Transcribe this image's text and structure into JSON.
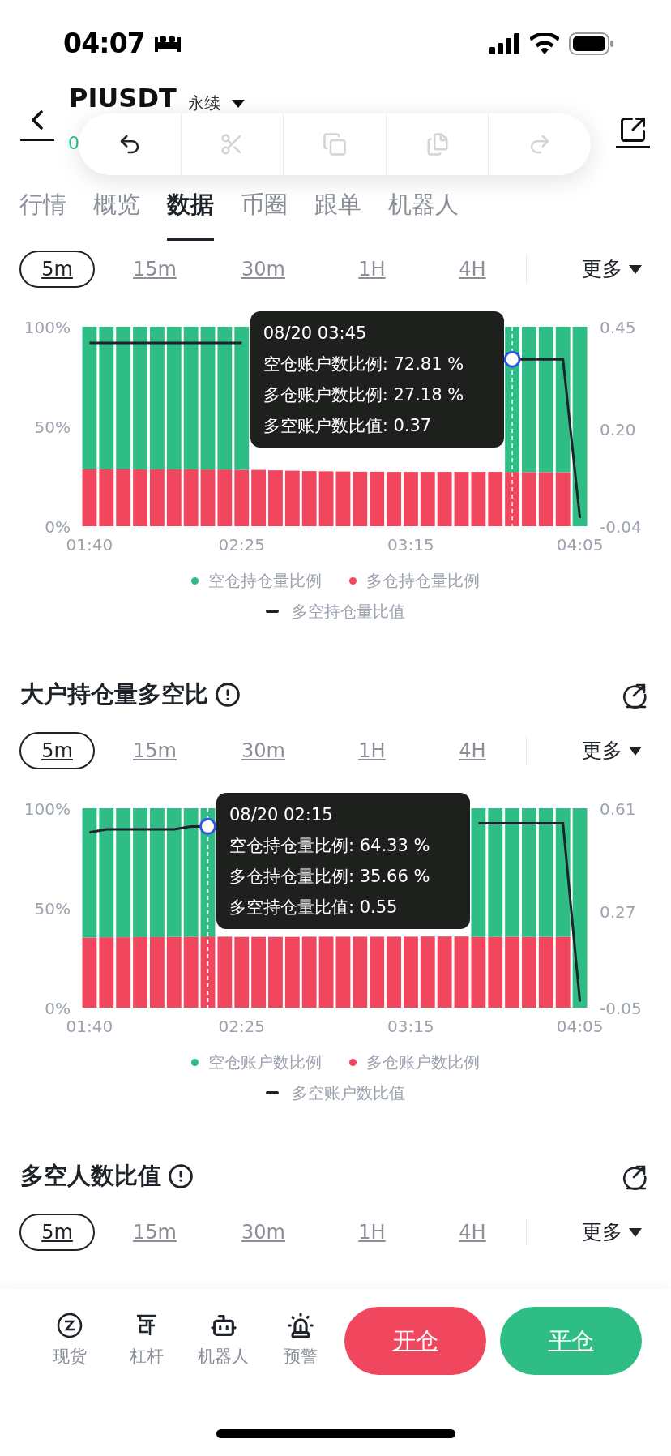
{
  "status_bar": {
    "time": "04:07"
  },
  "header": {
    "symbol": "PIUSDT",
    "contract": "永续",
    "price_fragment": "0"
  },
  "edit_toolbar": {
    "items": [
      {
        "kind": "undo",
        "disabled": false
      },
      {
        "kind": "cut",
        "disabled": true
      },
      {
        "kind": "copy",
        "disabled": true
      },
      {
        "kind": "paste",
        "disabled": true
      },
      {
        "kind": "redo",
        "disabled": true
      }
    ]
  },
  "tabs": [
    {
      "label": "行情",
      "selected": false
    },
    {
      "label": "概览",
      "selected": false
    },
    {
      "label": "数据",
      "selected": true
    },
    {
      "label": "币圈",
      "selected": false
    },
    {
      "label": "跟单",
      "selected": false
    },
    {
      "label": "机器人",
      "selected": false
    }
  ],
  "sections": [
    {
      "intervals": [
        {
          "label": "5m",
          "selected": true
        },
        {
          "label": "15m",
          "selected": false
        },
        {
          "label": "30m",
          "selected": false
        },
        {
          "label": "1H",
          "selected": false
        },
        {
          "label": "4H",
          "selected": false
        }
      ],
      "more": "更多",
      "chart_data": {
        "type": "bar",
        "stacked": true,
        "categories": [
          "01:40",
          null,
          null,
          null,
          null,
          null,
          null,
          null,
          null,
          "02:25",
          null,
          null,
          null,
          null,
          null,
          null,
          null,
          null,
          null,
          "03:15",
          null,
          null,
          null,
          null,
          null,
          null,
          null,
          null,
          null,
          "04:05"
        ],
        "ylim": [
          0,
          100
        ],
        "yticks": [
          {
            "value": 0,
            "label": "0%"
          },
          {
            "value": 50,
            "label": "50%"
          },
          {
            "value": 100,
            "label": "100%"
          }
        ],
        "y2lim": [
          -0.04,
          0.45
        ],
        "y2ticks": [
          {
            "value": -0.04,
            "label": "-0.04"
          },
          {
            "value": 0.2,
            "label": "0.20"
          },
          {
            "value": 0.45,
            "label": "0.45"
          }
        ],
        "legend": true,
        "series": [
          {
            "name": "空仓持仓量比例",
            "color": "#2ebd85",
            "values": [
              71.4,
              71.4,
              71.4,
              71.5,
              71.5,
              71.5,
              71.5,
              71.6,
              71.6,
              71.7,
              null,
              null,
              null,
              null,
              null,
              null,
              null,
              null,
              null,
              null,
              null,
              null,
              null,
              null,
              null,
              72.8,
              72.9,
              72.9,
              73.0,
              100
            ]
          },
          {
            "name": "多仓持仓量比例",
            "color": "#f0475f",
            "values": [
              28.6,
              28.6,
              28.6,
              28.5,
              28.5,
              28.5,
              28.5,
              28.4,
              28.4,
              28.3,
              28.2,
              28.0,
              27.8,
              27.6,
              27.5,
              27.4,
              27.3,
              27.3,
              27.2,
              27.2,
              27.2,
              27.2,
              27.2,
              27.2,
              27.2,
              27.2,
              27.1,
              27.1,
              27.0,
              0
            ]
          },
          {
            "name": "多空持仓量比值",
            "type": "line",
            "axis": "y2",
            "color": "#1e2329",
            "values": [
              0.41,
              0.41,
              0.41,
              0.41,
              0.41,
              0.41,
              0.41,
              0.41,
              0.41,
              0.41,
              null,
              null,
              null,
              null,
              null,
              null,
              null,
              null,
              null,
              null,
              null,
              null,
              null,
              null,
              null,
              0.37,
              0.37,
              0.37,
              0.37,
              -0.02
            ]
          }
        ]
      },
      "tooltip": {
        "title": "08/20 03:45",
        "lines": [
          "空仓账户数比例: 72.81 %",
          "多仓账户数比例: 27.18 %",
          "多空账户数比值: 0.37"
        ]
      }
    },
    {
      "title": "大户持仓量多空比",
      "intervals": [
        {
          "label": "5m",
          "selected": true
        },
        {
          "label": "15m",
          "selected": false
        },
        {
          "label": "30m",
          "selected": false
        },
        {
          "label": "1H",
          "selected": false
        },
        {
          "label": "4H",
          "selected": false
        }
      ],
      "more": "更多",
      "chart_data": {
        "type": "bar",
        "stacked": true,
        "categories": [
          "01:40",
          null,
          null,
          null,
          null,
          null,
          null,
          null,
          null,
          "02:25",
          null,
          null,
          null,
          null,
          null,
          null,
          null,
          null,
          null,
          "03:15",
          null,
          null,
          null,
          null,
          null,
          null,
          null,
          null,
          null,
          "04:05"
        ],
        "ylim": [
          0,
          100
        ],
        "yticks": [
          {
            "value": 0,
            "label": "0%"
          },
          {
            "value": 50,
            "label": "50%"
          },
          {
            "value": 100,
            "label": "100%"
          }
        ],
        "y2lim": [
          -0.05,
          0.61
        ],
        "y2ticks": [
          {
            "value": -0.05,
            "label": "-0.05"
          },
          {
            "value": 0.27,
            "label": "0.27"
          },
          {
            "value": 0.61,
            "label": "0.61"
          }
        ],
        "legend": true,
        "series": [
          {
            "name": "空仓账户数比例",
            "color": "#2ebd85",
            "values": [
              64.8,
              64.7,
              64.7,
              64.6,
              64.6,
              64.5,
              64.4,
              64.3,
              null,
              null,
              null,
              null,
              null,
              null,
              null,
              null,
              null,
              null,
              null,
              null,
              null,
              null,
              null,
              64.4,
              64.4,
              64.4,
              64.4,
              64.4,
              64.4,
              100
            ]
          },
          {
            "name": "多仓账户数比例",
            "color": "#f0475f",
            "values": [
              35.2,
              35.3,
              35.3,
              35.4,
              35.4,
              35.5,
              35.6,
              35.7,
              35.6,
              35.5,
              35.5,
              35.5,
              35.5,
              35.6,
              35.6,
              35.6,
              35.6,
              35.6,
              35.6,
              35.6,
              35.7,
              35.7,
              35.7,
              35.6,
              35.6,
              35.6,
              35.6,
              35.6,
              35.6,
              0
            ]
          },
          {
            "name": "多空账户数比值",
            "type": "line",
            "axis": "y2",
            "color": "#1e2329",
            "values": [
              0.53,
              0.54,
              0.54,
              0.54,
              0.54,
              0.54,
              0.55,
              0.55,
              null,
              null,
              null,
              null,
              null,
              null,
              null,
              null,
              null,
              null,
              null,
              null,
              null,
              null,
              null,
              0.56,
              0.56,
              0.56,
              0.56,
              0.56,
              0.56,
              -0.03
            ]
          }
        ]
      },
      "tooltip": {
        "title": "08/20 02:15",
        "lines": [
          "空仓持仓量比例: 64.33 %",
          "多仓持仓量比例: 35.66 %",
          "多空持仓量比值: 0.55"
        ]
      }
    },
    {
      "title": "多空人数比值",
      "intervals": [
        {
          "label": "5m",
          "selected": true
        },
        {
          "label": "15m",
          "selected": false
        },
        {
          "label": "30m",
          "selected": false
        },
        {
          "label": "1H",
          "selected": false
        },
        {
          "label": "4H",
          "selected": false
        }
      ],
      "more": "更多"
    }
  ],
  "bottom_nav": {
    "items": [
      {
        "label": "现货",
        "kind": "spot"
      },
      {
        "label": "杠杆",
        "kind": "margin"
      },
      {
        "label": "机器人",
        "kind": "bot"
      },
      {
        "label": "预警",
        "kind": "alert"
      }
    ],
    "buttons": [
      {
        "label": "开仓",
        "kind": "open"
      },
      {
        "label": "平仓",
        "kind": "close"
      }
    ]
  }
}
